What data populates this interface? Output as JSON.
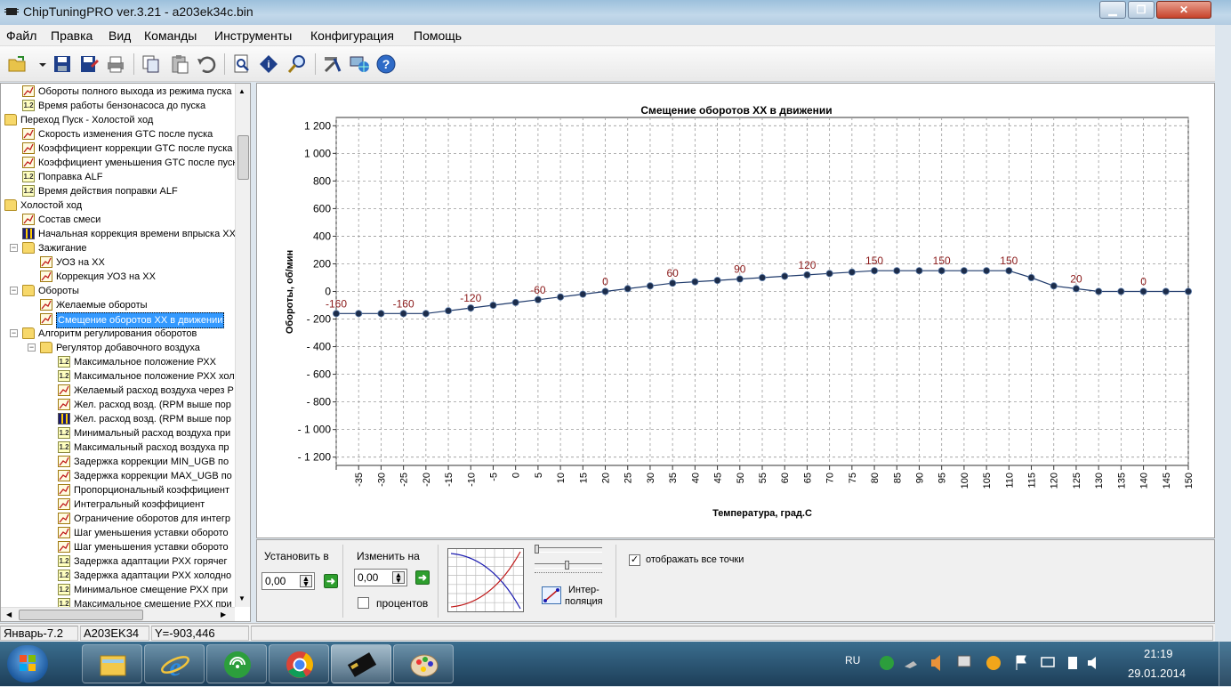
{
  "window": {
    "title": "ChipTuningPRO ver.3.21 - a203ek34c.bin"
  },
  "menu": {
    "items": [
      "Файл",
      "Правка",
      "Вид",
      "Команды",
      "Инструменты",
      "Конфигурация",
      "Помощь"
    ]
  },
  "toolbar": {
    "icons": [
      "open-icon",
      "dropdown-icon",
      "save-icon",
      "save-as-icon",
      "print-icon",
      "copy-icon",
      "paste-icon",
      "undo-icon",
      "search-doc-icon",
      "info-icon",
      "zoom-icon",
      "tools-icon",
      "network-icon",
      "help-icon"
    ]
  },
  "tree": {
    "items": [
      {
        "label": "Обороты полного выхода из режима пуска",
        "icon": "graph",
        "level": 1
      },
      {
        "label": "Время работы бензонасоса до пуска",
        "icon": "table",
        "level": 1
      },
      {
        "label": "Переход Пуск - Холостой ход",
        "icon": "folder",
        "level": 0
      },
      {
        "label": "Скорость изменения GTC после пуска",
        "icon": "graph",
        "level": 1
      },
      {
        "label": "Коэффициент коррекции GTC после пуска",
        "icon": "graph",
        "level": 1
      },
      {
        "label": "Коэффициент уменьшения GTC после пуска",
        "icon": "graph",
        "level": 1
      },
      {
        "label": "Поправка ALF",
        "icon": "table",
        "level": 1
      },
      {
        "label": "Время действия поправки ALF",
        "icon": "table",
        "level": 1
      },
      {
        "label": "Холостой ход",
        "icon": "folder",
        "level": 0
      },
      {
        "label": "Состав смеси",
        "icon": "graph",
        "level": 1
      },
      {
        "label": "Начальная коррекция времени впрыска ХХ",
        "icon": "bars",
        "level": 1
      },
      {
        "label": "Зажигание",
        "icon": "folder",
        "level": 1
      },
      {
        "label": "УОЗ на ХХ",
        "icon": "graph",
        "level": 2
      },
      {
        "label": "Коррекция УОЗ на ХХ",
        "icon": "graph",
        "level": 2
      },
      {
        "label": "Обороты",
        "icon": "folder",
        "level": 1
      },
      {
        "label": "Желаемые обороты",
        "icon": "graph",
        "level": 2
      },
      {
        "label": "Смещение оборотов ХХ в движении",
        "icon": "graph",
        "level": 2,
        "selected": true
      },
      {
        "label": "Алгоритм регулирования оборотов",
        "icon": "folder",
        "level": 1
      },
      {
        "label": "Регулятор добавочного воздуха",
        "icon": "folder",
        "level": 2
      },
      {
        "label": "Максимальное положение РХХ",
        "icon": "table",
        "level": 3
      },
      {
        "label": "Максимальное положение РХХ хол",
        "icon": "table",
        "level": 3
      },
      {
        "label": "Желаемый расход воздуха через Р",
        "icon": "graph",
        "level": 3
      },
      {
        "label": "Жел. расход возд. (RPM выше пор",
        "icon": "graph",
        "level": 3
      },
      {
        "label": "Жел. расход возд. (RPM выше пор",
        "icon": "bars",
        "level": 3
      },
      {
        "label": "Минимальный расход воздуха при",
        "icon": "table",
        "level": 3
      },
      {
        "label": "Максимальный расход воздуха пр",
        "icon": "table",
        "level": 3
      },
      {
        "label": "Задержка коррекции MIN_UGB по",
        "icon": "graph",
        "level": 3
      },
      {
        "label": "Задержка коррекции MAX_UGB по",
        "icon": "graph",
        "level": 3
      },
      {
        "label": "Пропорциональный коэффициент",
        "icon": "graph",
        "level": 3
      },
      {
        "label": "Интегральный коэффициент",
        "icon": "graph",
        "level": 3
      },
      {
        "label": "Ограничение оборотов для интегр",
        "icon": "graph",
        "level": 3
      },
      {
        "label": "Шаг уменьшения уставки оборото",
        "icon": "graph",
        "level": 3
      },
      {
        "label": "Шаг уменьшения уставки оборото",
        "icon": "graph",
        "level": 3
      },
      {
        "label": "Задержка адаптации РХХ горячег",
        "icon": "table",
        "level": 3
      },
      {
        "label": "Задержка адаптации РХХ холодно",
        "icon": "table",
        "level": 3
      },
      {
        "label": "Минимальное смещение РХХ при",
        "icon": "table",
        "level": 3
      },
      {
        "label": "Максимальное смещение РХХ при",
        "icon": "table",
        "level": 3
      }
    ]
  },
  "chart_data": {
    "type": "line",
    "title": "Смещение оборотов ХХ в движении",
    "xlabel": "Температура, град.С",
    "ylabel": "Обороты, об/мин",
    "ylim": [
      -1200,
      1200
    ],
    "yticks": [
      1200,
      1000,
      800,
      600,
      400,
      200,
      0,
      -200,
      -400,
      -600,
      -800,
      -1000,
      -1200
    ],
    "ytick_labels": [
      "1 200",
      "1 000",
      "800",
      "600",
      "400",
      "200",
      "0",
      "- 200",
      "- 400",
      "- 600",
      "- 800",
      "- 1 000",
      "- 1 200"
    ],
    "x": [
      -40,
      -35,
      -30,
      -25,
      -20,
      -15,
      -10,
      -5,
      0,
      5,
      10,
      15,
      20,
      25,
      30,
      35,
      40,
      45,
      50,
      55,
      60,
      65,
      70,
      75,
      80,
      85,
      90,
      95,
      100,
      105,
      110,
      115,
      120,
      125,
      130,
      135,
      140,
      145,
      150
    ],
    "xtick_labels": [
      "-35",
      "-30",
      "-25",
      "-20",
      "-15",
      "-10",
      "-5",
      "0",
      "5",
      "10",
      "15",
      "20",
      "25",
      "30",
      "35",
      "40",
      "45",
      "50",
      "55",
      "60",
      "65",
      "70",
      "75",
      "80",
      "85",
      "90",
      "95",
      "100",
      "105",
      "110",
      "115",
      "120",
      "125",
      "130",
      "135",
      "140",
      "145",
      "150"
    ],
    "series": [
      {
        "values": [
          -160,
          -160,
          -160,
          -160,
          -160,
          -140,
          -120,
          -100,
          -80,
          -60,
          -40,
          -20,
          0,
          20,
          40,
          60,
          70,
          80,
          90,
          100,
          110,
          120,
          130,
          140,
          150,
          150,
          150,
          150,
          150,
          150,
          150,
          100,
          40,
          20,
          0,
          0,
          0,
          0,
          0
        ]
      }
    ],
    "point_labels": [
      {
        "x": -40,
        "text": "-160"
      },
      {
        "x": -25,
        "text": "-160"
      },
      {
        "x": -10,
        "text": "-120"
      },
      {
        "x": 5,
        "text": "-60"
      },
      {
        "x": 20,
        "text": "0"
      },
      {
        "x": 35,
        "text": "60"
      },
      {
        "x": 50,
        "text": "90"
      },
      {
        "x": 65,
        "text": "120"
      },
      {
        "x": 80,
        "text": "150"
      },
      {
        "x": 95,
        "text": "150"
      },
      {
        "x": 110,
        "text": "150"
      },
      {
        "x": 125,
        "text": "20"
      },
      {
        "x": 140,
        "text": "0"
      }
    ],
    "grid": true,
    "line_color": "#1f3a6b",
    "label_color": "#8b1a1a"
  },
  "controls": {
    "set_label": "Установить в",
    "set_value": "0,00",
    "change_label": "Изменить на",
    "change_value": "0,00",
    "percent_label": "процентов",
    "interp_label_1": "Интер-",
    "interp_label_2": "поляция",
    "show_points_label": "отображать все точки",
    "show_points_checked": "✓",
    "go_symbol": "➜"
  },
  "status": {
    "cell1": "Январь-7.2",
    "cell2": "A203EK34",
    "cell3": "Y=-903,446"
  },
  "taskbar": {
    "lang": "RU",
    "time": "21:19",
    "date": "29.01.2014",
    "apps": [
      "windows-start-icon",
      "file-explorer-icon",
      "internet-explorer-icon",
      "network-app-icon",
      "chrome-icon",
      "chiptuning-icon",
      "paint-icon"
    ]
  }
}
